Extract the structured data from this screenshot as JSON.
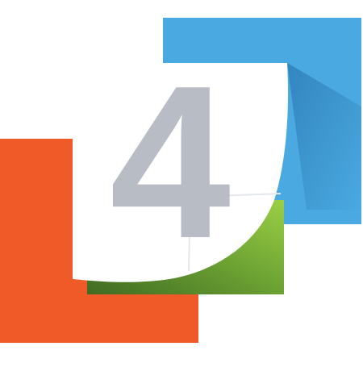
{
  "logo": {
    "digit": "4",
    "colors": {
      "red": "#f05a28",
      "blue": "#4aa9e1",
      "green": "#8dc63f",
      "green_dark": "#4e7c2a",
      "page": "#ffffff",
      "digit": "#b8bcc4"
    }
  }
}
